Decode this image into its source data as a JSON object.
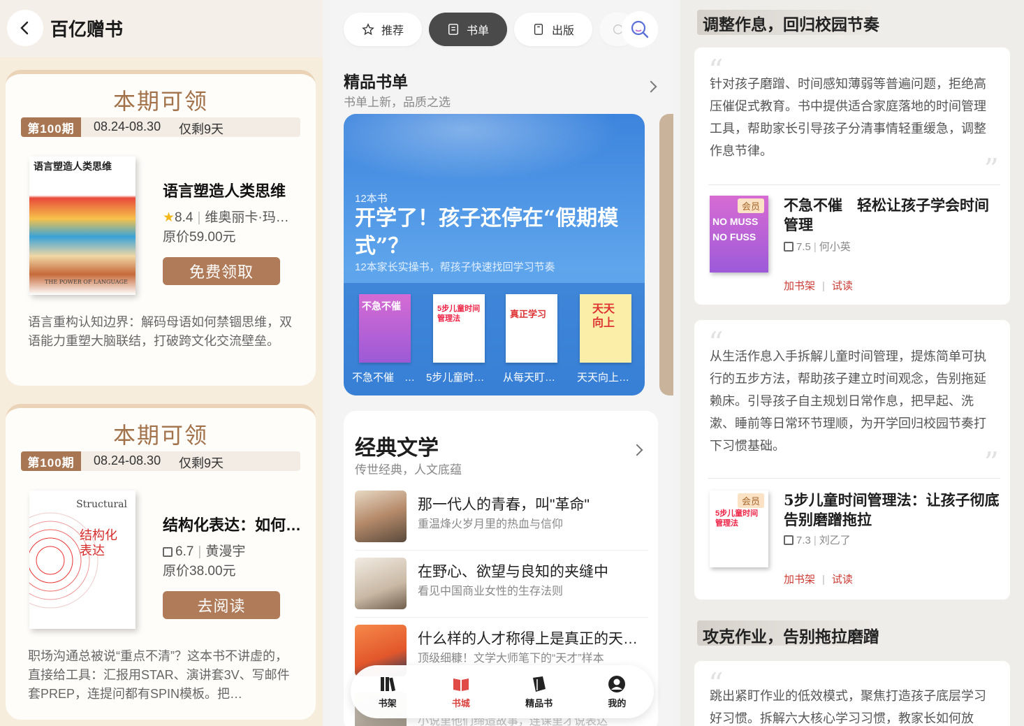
{
  "panel1": {
    "title": "百亿赠书",
    "cards": [
      {
        "heading": "本期可领",
        "period_tag": "第100期",
        "period_dates": "08.24-08.30",
        "period_left": "仅剩9天",
        "book_title": "语言塑造人类思维",
        "rating": "8.4",
        "author": "维奥丽卡·玛…",
        "price": "原价59.00元",
        "cta": "免费领取",
        "cover_title": "语言塑造人类思维",
        "cover_sub": "THE POWER OF LANGUAGE",
        "desc": "语言重构认知边界：解码母语如何禁锢思维，双语能力重塑大脑联结，打破跨文化交流壁垒。"
      },
      {
        "heading": "本期可领",
        "period_tag": "第100期",
        "period_dates": "08.24-08.30",
        "period_left": "仅剩9天",
        "book_title": "结构化表达：如何…",
        "rating": "6.7",
        "author": "黄漫宇",
        "price": "原价38.00元",
        "cta": "去阅读",
        "cover_title": "结构化表达",
        "cover_en": "Structural",
        "desc": "职场沟通总被说“重点不清”？这本书不讲虚的，直接给工具：汇报用STAR、演讲套3V、写邮件套PREP，连提问都有SPIN模板。把…"
      }
    ]
  },
  "panel2": {
    "tabs": [
      {
        "label": "推荐",
        "icon": "star-icon"
      },
      {
        "label": "书单",
        "icon": "list-icon"
      },
      {
        "label": "出版",
        "icon": "book-icon"
      }
    ],
    "section1": {
      "title": "精品书单",
      "subtitle": "书单上新，品质之选"
    },
    "banner": {
      "count": "12本书",
      "title": "开学了！孩子还停在“假期模式”？",
      "subtitle": "12本家长实操书，帮孩子快速找回学习节奏",
      "books": [
        {
          "label": "不急不催　…",
          "cover_text": "不急不催"
        },
        {
          "label": "5步儿童时…",
          "cover_text": "5步儿童时间管理法"
        },
        {
          "label": "从每天盯…",
          "cover_text": "真正学习"
        },
        {
          "label": "天天向上…",
          "cover_text": "天天向上"
        }
      ]
    },
    "section2": {
      "title": "经典文学",
      "subtitle": "传世经典，人文底蕴",
      "items": [
        {
          "title": "那一代人的青春，叫\"革命\"",
          "sub": "重温烽火岁月里的热血与信仰"
        },
        {
          "title": "在野心、欲望与良知的夹缝中",
          "sub": "看见中国商业女性的生存法则"
        },
        {
          "title": "什么样的人才称得上是真正的天…",
          "sub": "顶级细糠！文学大师笔下的“天才”样本"
        },
        {
          "title": "",
          "sub": "小说里他们缔造故事，连课里才说表达"
        }
      ]
    },
    "nav": [
      {
        "label": "书架",
        "icon": "bookshelf-icon"
      },
      {
        "label": "书城",
        "icon": "bookstore-icon"
      },
      {
        "label": "精品书",
        "icon": "premium-book-icon"
      },
      {
        "label": "我的",
        "icon": "profile-icon"
      }
    ],
    "active_nav": "书城"
  },
  "panel3": {
    "heading1": "调整作息，回归校园节奏",
    "heading2": "攻克作业，告别拖拉磨蹭",
    "cards": [
      {
        "text": "针对孩子磨蹭、时间感知薄弱等普遍问题，拒绝高压催促式教育。书中提供适合家庭落地的时间管理工具，帮助家长引导孩子分清事情轻重缓急，调整作息节律。",
        "book_title": "不急不催　轻松让孩子学会时间管理",
        "rating": "7.5",
        "author": "何小英",
        "vip": "会员",
        "add": "加书架",
        "trial": "试读",
        "cover_text": "NO MUSS NO FUSS"
      },
      {
        "text": "从生活作息入手拆解儿童时间管理，提炼简单可执行的五步方法，帮助孩子建立时间观念，告别拖延赖床。引导孩子自主规划日常作息，把早起、洗漱、睡前等日常环节理顺，为开学回归校园节奏打下习惯基础。",
        "book_title": "5步儿童时间管理法：让孩子彻底告别磨蹭拖拉",
        "rating": "7.3",
        "author": "刘乙了",
        "vip": "会员",
        "add": "加书架",
        "trial": "试读",
        "cover_text": "5步儿童时间管理法"
      },
      {
        "text": "跳出紧盯作业的低效模式，聚焦打造孩子底层学习好习惯。拆解六大核心学习习惯，教家长如何放"
      }
    ],
    "separator": "|"
  },
  "colors": {
    "accent_brown": "#a97653",
    "accent_red": "#d9423e",
    "banner_blue": "#3c84dd"
  }
}
